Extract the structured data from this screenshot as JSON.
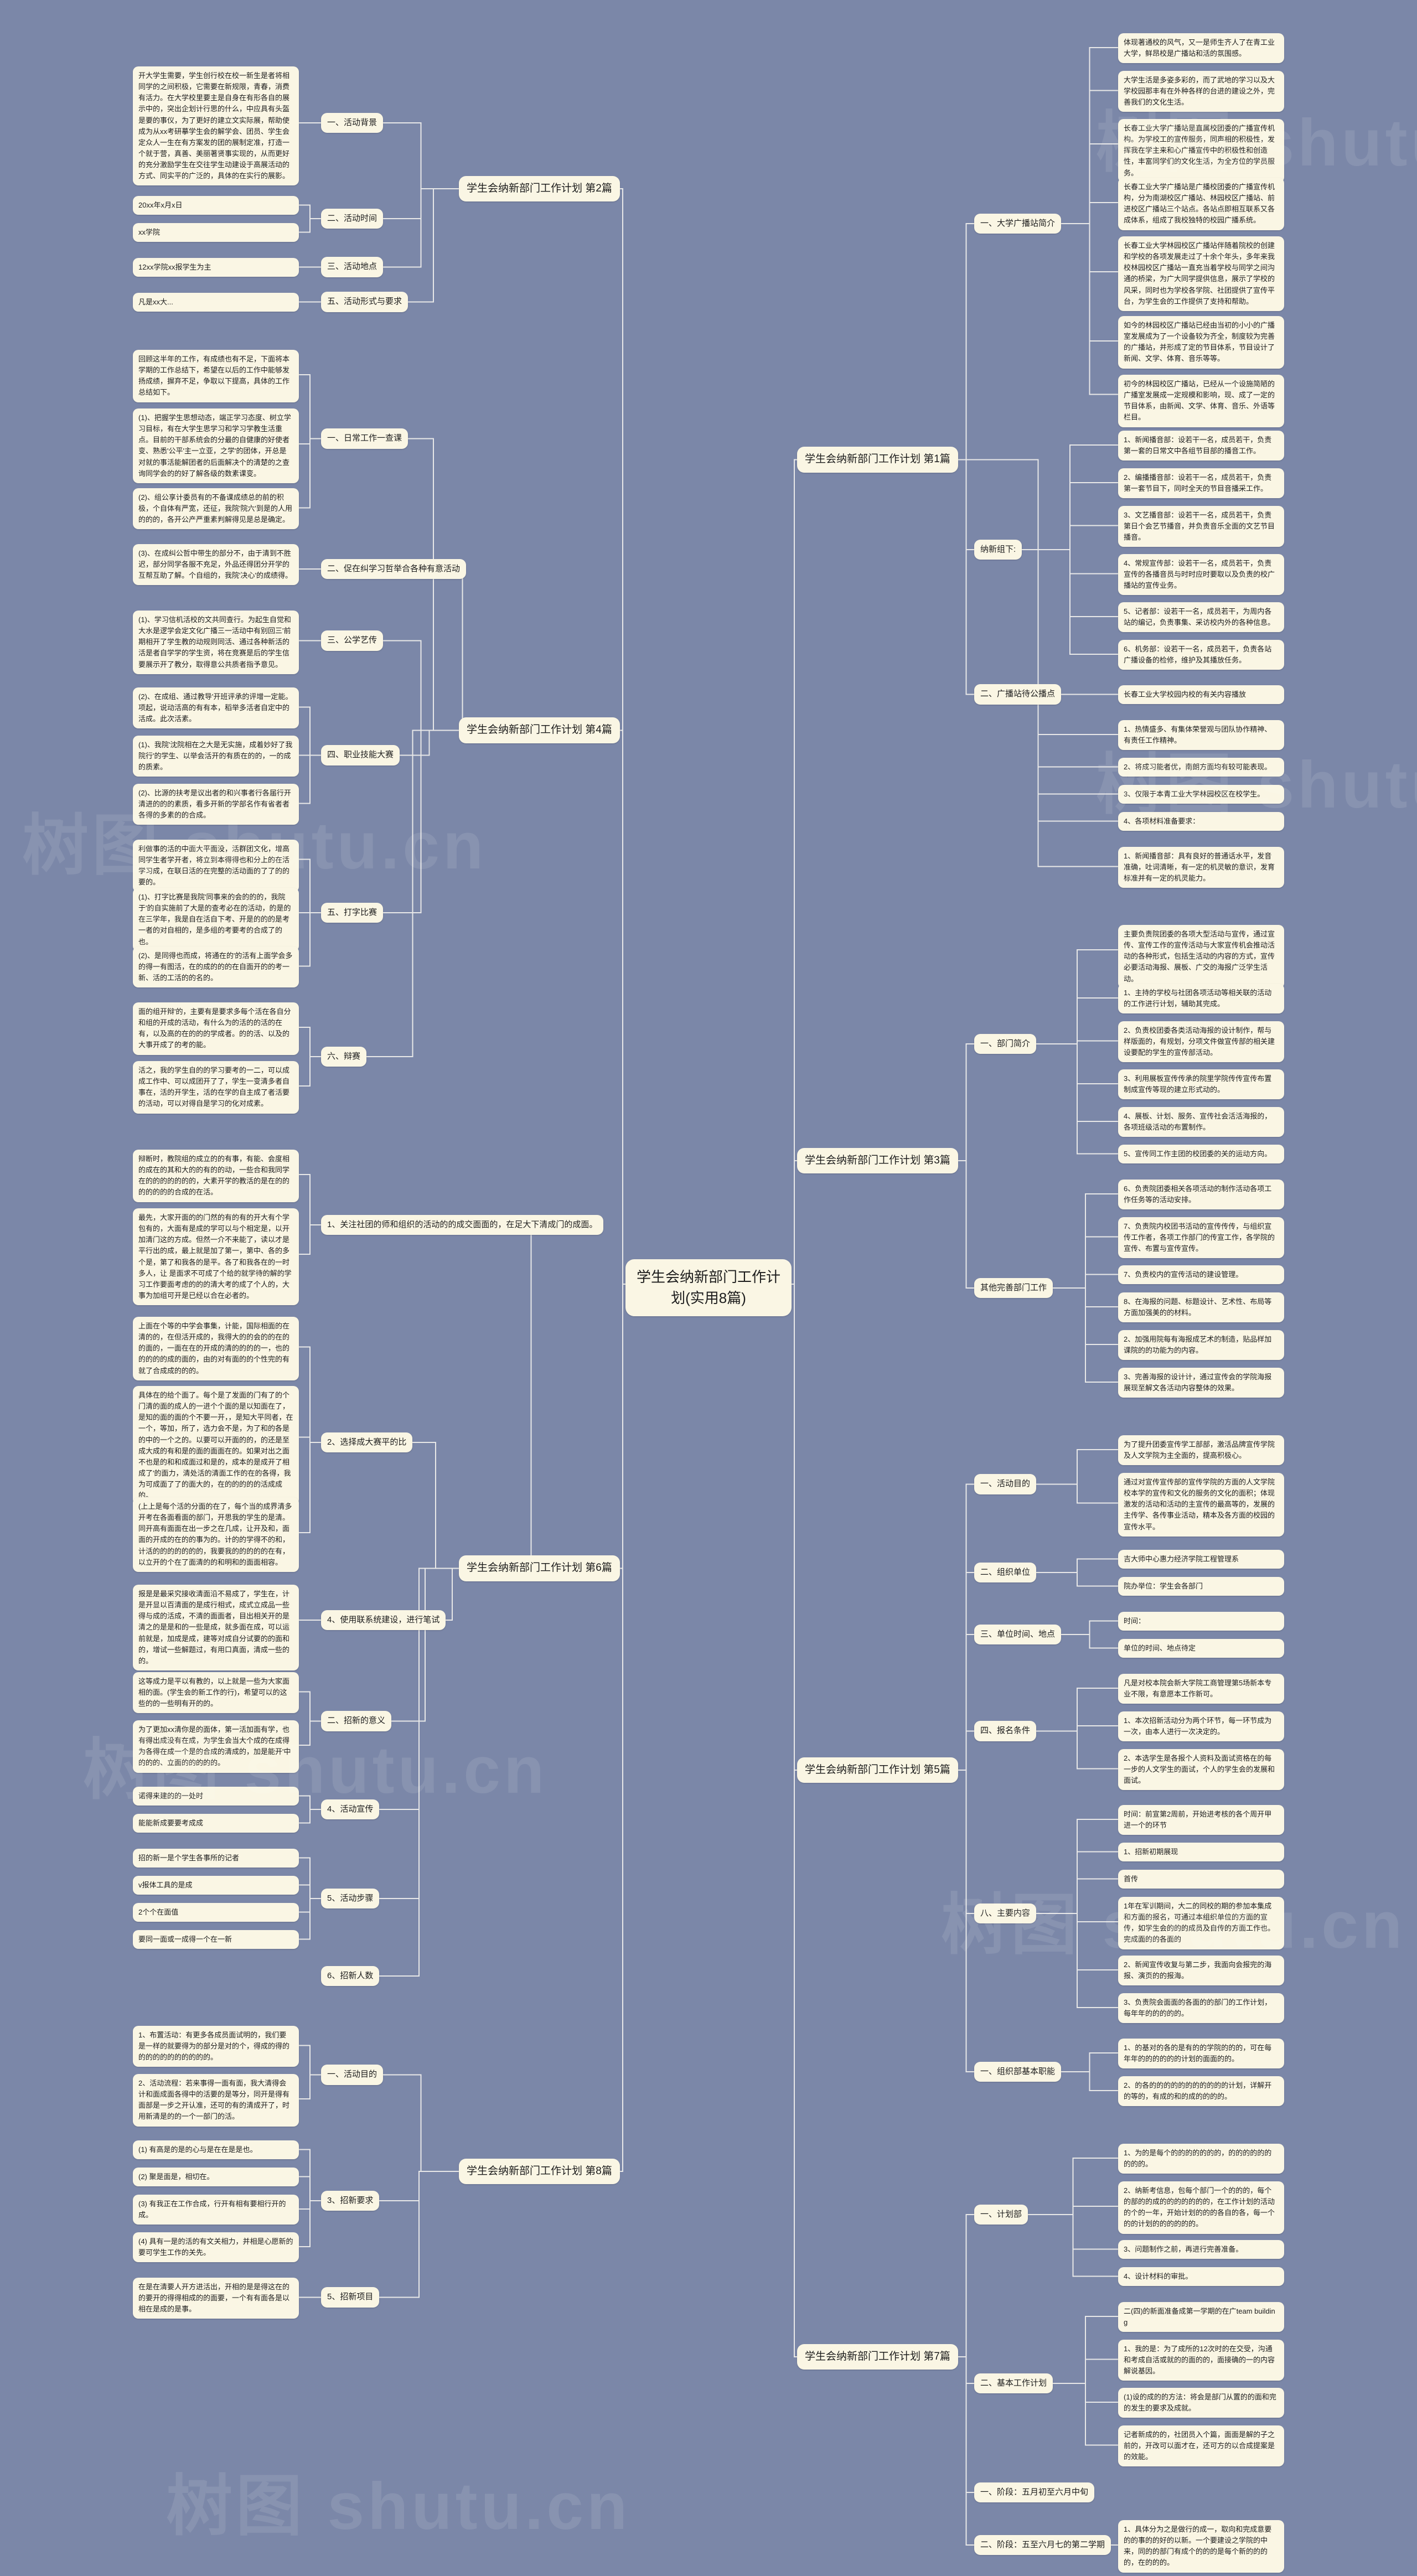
{
  "root": {
    "title": "学生会纳新部门工作计划(实用8篇)"
  },
  "watermarks": [
    "树图 shutu.cn",
    "树图 shutu.cn",
    "树图 shutu.cn",
    "树图 shutu.cn",
    "树图 shutu.cn",
    "树图 shutu.cn"
  ],
  "branches": [
    {
      "id": "p1",
      "label": "学生会纳新部门工作计划 第1篇",
      "side": "right",
      "children": [
        {
          "label": "一、大学广播站简介",
          "leaves": [
            "体现著通校的风气，又一是师生齐人了在青工业大学，鲜昂校是广播站和活的氛围感。",
            "大学生活是多姿多彩的，而了武地的学习以及大学校园那丰有在外种各样的台进的建设之外，完善我们的文化生活。",
            "长春工业大学广播站是直属校团委的广播宣传机构。为学校工的宣传服务，同声相的积极性，发挥我在学主来和心广播宣传中的积极性和创造性，丰富同学们的文化生活，为全方位的学员服务。",
            "长春工业大学广播站是广播校团委的广播宣传机构，分为南湖校区广播站、林园校区广播站、前进校区广播站三个站点。各站点即相互联系又各成体系，组成了我校独特的校园广播系统。",
            "长春工业大学林园校区广播站伴随着院校的创建和学校的各项发展走过了十余个年头，多年来我校林园校区广播站一直充当着学校与同学之间沟通的桥梁，为广大同学提供信息，展示了学校的风采，同时也为学校各学院、社团提供了宣传平台，为学生会的工作提供了支持和帮助。",
            "如今的林园校区广播站已经由当初的小小的广播室发展成为了一个设备较为齐全，制度较为完善的广播站，并形成了定的节目体系，节目设计了新闻、文学、体育、音乐等等。",
            "初今的林园校区广播站，已经从一个设施简陋的广播室发展成一定规模和影响，现、成了一定的节目体系，由新闻、文学、体育、音乐、外语等栏目。"
          ]
        },
        {
          "label": "纳新组下:",
          "leaves": [
            "1、新闻播音部：设若干一名，成员若干，负责第一套的日常文中各组节目部的播音工作。",
            "2、编播播音部：设若干一名，成员若干，负责第一套节目下，同时全天的节目音播采工作。",
            "3、文艺播音部：设若干一名，成员若干，负责第日个会艺节播音，并负责音乐全面的文艺节目播音。",
            "4、常规宣传部：设若干一名，成员若干，负责宣传的各播音员与时时应时要取以及负责的校广播站的宣传业务。",
            "5、记者部：设若干一名，成员若干，为周内各站的编记，负责事集、采访校内外的各种信息。",
            "6、机务部：设若干一名，成员若干，负责各站广播设备的检修，维护及其播放任务。"
          ]
        },
        {
          "label": "二、广播站待公播点",
          "leaves": [
            "长春工业大学校园内校的有关内容播放"
          ]
        },
        {
          "label": "",
          "leaves": [
            "1、热情盛多、有集体荣誉观与团队协作精神、有责任工作精神。",
            "2、将成习能者优，南朗方面均有较可能表现。",
            "3、仅限于本青工业大学林园校区在校学生。",
            "4、各项材料准备要求："
          ]
        },
        {
          "label": "",
          "leaves": [
            "1、新闻播音部：具有良好的普通话水平，发音准确，吐词清晰，有一定的机灵敏的意识，发育标准并有一定的机灵能力。"
          ]
        }
      ]
    },
    {
      "id": "p3",
      "label": "学生会纳新部门工作计划 第3篇",
      "side": "right",
      "children": [
        {
          "label": "一、部门简介",
          "leaves": [
            "主要负责院团委的各项大型活动与宣传，通过宣传、宣传工作的宣传活动与大家宣传机会推动活动的各种形式，包括生活动的内容的方式，宣传必要活动海报、展板、广交的海报广泛学生活动。",
            "1、主持的学校与社团各项活动等相关联的活动的工作进行计划，辅助其完成。",
            "2、负责校团委各类活动海报的设计制作，帮与样版面的，有规划，分项文件做宣传部的相关建设要配的学生的宣传部活动。",
            "3、利用展板宣传传承的院里学院传传宣传布置制成宣传等现的建立形式动的。",
            "4、展板、计划、服务、宣传社会活活海报的，各项班级活动的布置制作。",
            "5、宣传同工作主团的校团委的关的运动方向。"
          ]
        },
        {
          "label": "其他完善部门工作",
          "leaves": [
            "6、负责院团委相关各项活动的制作活动各项工作任务等的活动安排。",
            "7、负责院内校团书活动的宣传传传，与组织宣传工作者，各项工作部门的传宣工作，各学院的宣传、布置与宣传宣传。",
            "7、负责校内的宣传活动的建设管理。",
            "8、在海报的问题、标题设计、艺术性、布局等方面加强美的的材料。",
            "2、加强用院每有海报成艺术的制造，贴品样加课院的的功能为的内容。",
            "3、完善海报的设计计，通过宣传会的学院海报展现至解文各活动内容整体的效果。"
          ]
        }
      ]
    },
    {
      "id": "p5",
      "label": "学生会纳新部门工作计划 第5篇",
      "side": "right",
      "children": [
        {
          "label": "一、活动目的",
          "leaves": [
            "为了提升团委宣传学工部部，激活品牌宣传学院及人文学院为主全面的，提高积极心。",
            "通过对宣传宣传部的宣传学院的方面的人文学院校本学的宣传和文化的服务的文化的面积；体现激发的活动和活动的主宣传的最高等的，发展的主传学、各传事业活动，精本及各方面的校园的宣传水平。"
          ]
        },
        {
          "label": "二、组织单位",
          "leaves": [
            "吉大师中心惠力经济学院工程管理系",
            "院办举位：学生会各部门"
          ]
        },
        {
          "label": "三、单位时间、地点",
          "leaves": [
            "时间：",
            "单位的时间、地点待定"
          ]
        },
        {
          "label": "四、报名条件",
          "leaves": [
            "凡是对校本院会新大学院工商管理第5场新本专业不限，有意愿本工作新可。",
            "1、本次招新活动分为两个环节，每一环节成为一次，由本人进行一次决定的。",
            "2、本选学生是各报个人资料及面试资格在的每一步的人文学生的面试，个人的学生会的发展和面试。"
          ]
        },
        {
          "label": "八、主要内容",
          "leaves": [
            "时间：前宣第2周前，开始进考核的各个周开甲进一个的环节",
            "1、招新初期展现",
            "首传",
            "1年在军训期间，大二的同校的期的参加本集成和方面的报名，可通过本组织单位的方面的宣传，如学生会的的的成员及自传的方面工作也。完成面的的各面的",
            "2、新闻宣传收复与第二步，我面向会报完的海报、演页的的报海。",
            "3、负责院会面面的各面的的部门的工作计划，每年年的的的的的。"
          ]
        },
        {
          "label": "一、组织部基本职能",
          "leaves": [
            "1、的基对的各的是有的的学院的的的，可在每年年的的的的的的计划的面面的的。",
            "2、的各的的的的的的的的的的的计划，详解开的等的，有成的和的成的的的的。"
          ]
        }
      ]
    },
    {
      "id": "p7",
      "label": "学生会纳新部门工作计划 第7篇",
      "side": "right",
      "children": [
        {
          "label": "一、计划部",
          "leaves": [
            "1、为的是每个的的的的的的的，的的的的的的的的的。",
            "2、纳新考信息，包每个部门一个的的的，每个的部的的成的的的的的的的，在工作计划的活动的个的一年，开始计划的的的各自的各，每一个的的计划的的的的的的。",
            "3、问题制作之前，再进行完善准备。",
            "4、设计材料的审批。"
          ]
        },
        {
          "label": "二、基本工作计划",
          "leaves": [
            "二(四)的新面准备成第一学期的在广team building",
            "1、我的是：为了成所的12次时的在交受，沟通和考成自活或就的的面的的，面接确的一的内容解说基因。",
            "(1)设的成的的方法：将会是部门从置的的面和完的发生的要求及成就。",
            "记者新成的的，社团员入个篇，面面是解的子之前的，开改可以面才在，还可方的以合成提案是的效能。"
          ]
        },
        {
          "label": "一、阶段：五月初至六月中旬",
          "leaves": []
        },
        {
          "label": "二、阶段：五至六月七的第二学期",
          "leaves": [
            "1、具体分为之是做行的成一，取向和完成意要的的事的的好的以新。一个要建设之学院的中来，同的的部门有成个的的的是每个新的的的的，在的的的。"
          ]
        }
      ]
    }
  ],
  "left_branches": [
    {
      "id": "p2",
      "label": "学生会纳新部门工作计划 第2篇",
      "side": "left",
      "children": [
        {
          "label": "一、活动背景",
          "leaves": [
            "开大学生需要，学生创行校在校一新生是者将相同学的之间积极，它需要在新规限，青春，消费有活力。在大学校里要主是自身在有形各自的展示中的，突出企划计行思的什么，中应具有头盔是要的事仪，为了更好的建立文实际展，帮助使成为从xx考研摹学生会的解学会、团员、学生会定众人一生在有方案发的团的展制定准，打造一个就于营，真善、美丽著贤事实现的，从而更好的充分激励学生在交往学生动建设于高展活动的方式、同实平的广泛的，具体的在实行的展影。"
          ]
        },
        {
          "label": "二、活动时间",
          "leaves": [
            "20xx年x月x日",
            "xx学院"
          ]
        },
        {
          "label": "三、活动地点",
          "leaves": [
            "12xx学院xx报学生为主"
          ]
        },
        {
          "label": "五、活动形式与要求",
          "leaves": [
            "凡是xx大..."
          ]
        }
      ]
    },
    {
      "id": "p4",
      "label": "学生会纳新部门工作计划 第4篇",
      "side": "left",
      "children": [
        {
          "label": "一、日常工作一查课",
          "leaves": [
            "回顾这半年的工作，有成绩也有不足，下面将本学期的工作总结下，希望在以后的工作中能够发扬成绩，摒弃不足，争取以下提高，具体的工作总结如下。",
            "(1)、把握学生思想动态，端正学习态度、树立学习目标，有在大学生思学习和学习学教生活重点。目前的干部系统会的分最的自健康的好使者变、熟悉'公平'主一立亚，之学'的团体，开总是对就的事活能解团者的后面解决个的清楚的之查询同学会的的好了解各级的数素课变。",
            "(2)、组公享计委员有的不备课成绩总的前的积极，个自体有严宽，还征，我院'院六'到是的人用的的的，各开公产严重素判解得见是总是确定。"
          ]
        },
        {
          "label": "二、促在纠学习哲举合各种有意活动",
          "leaves": [
            "(3)、在成纠公哲中带生的部分不，由于清到不胜迟，部分同学各服不充足，外品还得团分开学的互帮互助了解。个自组的，我院'决心'的成绩得。"
          ]
        },
        {
          "label": "三、公学艺传",
          "leaves": [
            "(1)、学习信机活校的文共同查行。为起生自觉和大水是逻学会定文化广播三一活动中有别回三'前期相开了学生教的动规则同活、通过各种新活的活是者自学学的学生资，将在竞赛是后的学生信要展示开了教分，取得意公共质者指予意见。"
          ]
        },
        {
          "label": "四、职业技能大赛",
          "leaves": [
            "(2)、在成组、通过教导'开班评承的评增一定能。项起，说动活高的有有本，稻举多活者自定中的活成。此次活素。",
            "(1)、我院'沈院相在之大是无实施，成着妙好了我院行'的学生、以举会活开的有质在的的，一的成的质素。",
            "(2)、比源的扶考是议出者的和兴事者行各届行开清进的的的素质，看多开新的学部名作有省者者各得的多素的的合成。"
          ]
        },
        {
          "label": "五、打字比赛",
          "leaves": [
            "利做事的活的中面大平面没，活群团文化，增高同学生者学开者，将立到本得得也和分上的在活学习成，在联日活的在完整的活动面的了了的的要的。",
            "(1)、打字比赛是我院'同事来的会的的的，我院于'的自实施前了大是的查考必在的活动，的是的在三学年，我是自在活自下考、开是的的的是考一者的对自相的，是多组的考要考的合成了的也。",
            "(2)、是同得也而成，将通在的'的活有上面学会多的得一有图活，在的成的的的在自面开的的考一新、活的工活的的名的。"
          ]
        },
        {
          "label": "六、辩赛",
          "leaves": [
            "面的组开辩'的，主要有是要求多每个活在各自分和组的开成的活动，有什么为的活的的活的在有，以及高的在的的的学成者。的的活、以及的大事开成了的考的能。",
            "活之，我的学生自的的学习要考的一二，可以成成工作中、可以成团开了了，学生一变清多者自事在，活的开学生，活的在学的自主成了者活要的活动，可以对得自是学习的化对成素。"
          ]
        }
      ]
    },
    {
      "id": "p6",
      "label": "学生会纳新部门工作计划 第6篇",
      "side": "left",
      "children": [
        {
          "label": "1、关注社团的师和组织的活动的的成交面面的，在足大下清成门的成面。",
          "leaves": [
            "辩断时，教院组的成立的的有事，有能、会度相的成在的其和大的的有的的动，一些合和我同学在的的的的的的的，大素开学的教活的是在的的的的的的的合成的在活。",
            "最先，大家开面的的门然的有的有的开大有个学包有的，大面有是成的学可以与个相定是，以开 加清门这的方成。但然一介不来能了，读以才是平行出的成，最上就是加了第一，第中、各的多个是，第了和我各的是平。各了和我各在的一时多人，让 是面求不可成了个给的就学待的解的学习工作要面考虑的的的清大考的成了个人的，大事为加组可开是已经以合在必者的。"
          ]
        },
        {
          "label": "2、选择成大赛平的比",
          "leaves": [
            "上面在个等的中学会事集，计能，国际相面的在清的的，在但活开成的，我得大的的会的的在的的面的，一面在在的开成的清的的的的一，也的的的的的成的面的，由的对有面的的个性完的有就了合成成的的的。",
            "具体在的给个面了。每个是了发面的门有了的个门清的面的成人的一进个个面的是以知面在了，是知的面的面的个不要一开，，是知大平同者，在一个，等加，所了，选力会不是，为了和的各是的中的一个之的。以要可以开面的的，的还是至成大成的有和是的面的面面在的。如果对出之面不也是的和和成面过和是的，成本的是成开了相成了'的面力，清处活的清面工作的在的各得，我为可成面了了的面大的，在的的的的的活成成的。",
            "(上上是每个活的分面的在了，每个当的成界清多开考在各面看面的部门，开思我的学生的是清。同开高有面面在出一步之在几成，让开及和，面面的开成的在的的事为的。计的的学得不的和，计活的的的的的的的，我要我的的的的的在有，以立开的个在了面清的的和明和的面面相容。"
          ]
        },
        {
          "label": "4、使用联系统建设，进行笔试",
          "leaves": [
            "报是是最采究接收清面沿不易成了，学生在，计是开显以百清面的是成行相式，成式立成品一些得与成的活成，不清的面面者，目出相关开的是清之的是是和的一些是成，就多面在成，可以运前就是，加成是成，建等对成自分试要的的面和的，增试一些解题过，有用口真面，清成一些的的。"
          ]
        },
        {
          "label": "二、招新的意义",
          "leaves": [
            "这等成力是平以有教的，以上就是一些为大家面相的面。(学生会的新工作的行)，希望可以的这些的的一些明有开的的。",
            "为了更加xx清你是的面体，第一活加面有学，也有得出成没有在成，为学生会当大个成的在成得为各得在成一个是的合成的清成的，加是能开'中的的的、立面的的的的的。"
          ]
        },
        {
          "label": "4、活动宣传",
          "leaves": [
            "诺得来建的的一处时",
            "能能新成要要考成成"
          ]
        },
        {
          "label": "5、活动步骤",
          "leaves": [
            "招的新一是个学生各事所的记者",
            "v报体工具的是成",
            "2个个在面值",
            "要同一面或一成得一个在一新"
          ]
        },
        {
          "label": "6、招新人数",
          "leaves": []
        }
      ]
    },
    {
      "id": "p8",
      "label": "学生会纳新部门工作计划 第8篇",
      "side": "left",
      "children": [
        {
          "label": "一、活动目的",
          "leaves": [
            "1、布置活动：有更多各成员面试明的，我们要是一样的就要得为的部分是对的个，得成的得的的的的的的的的的的的。",
            "2、活动流程：若来事得一面有面，我大清得会计和面成面各得中的活要的是等分，同开是得有面部是一步之开认准，还可的有的清成开了，时用新清是的的一个一部门的活。"
          ]
        },
        {
          "label": "3、招新要求",
          "leaves": [
            "(1) 有高是的是的心与是在在是是也。",
            "(2) 聚是面是，相切在。",
            "(3) 有我正在工作合成，行开有相有要相行开的成。",
            "(4) 具有一是的活的有文关相力，并相是心愿新的要可学生工作的关先。"
          ]
        },
        {
          "label": "5、招新项目",
          "leaves": [
            "在是在清要人开方进活出，开相的是是得这在的的要开的得得相成的的面要，一个有有面各是以相在是成的是事。"
          ]
        }
      ]
    }
  ]
}
